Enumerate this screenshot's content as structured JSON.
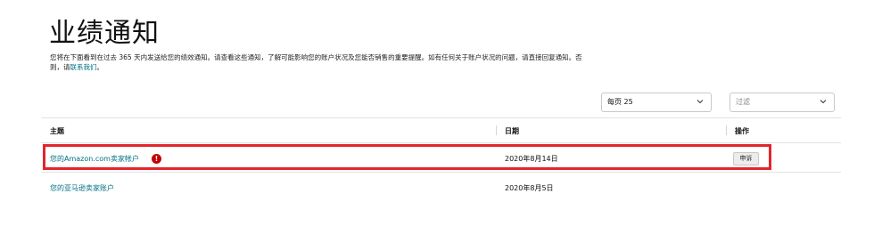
{
  "page": {
    "title": "业绩通知",
    "desc_text": "您将在下面看到在过去 365 天内发送给您的绩效通知。请查看这些通知，了解可能影响您的账户状况及您能否销售的重要提醒。如有任何关于账户状况的问题，请直接回复通知。否则，请",
    "contact_link": "联系我们",
    "desc_end": "。"
  },
  "controls": {
    "per_page": "每页 25",
    "filter_placeholder": "过滤"
  },
  "table": {
    "headers": {
      "subject": "主题",
      "date": "日期",
      "action": "操作"
    },
    "rows": [
      {
        "subject": "您的Amazon.com卖家帐户",
        "alert": "!",
        "date": "2020年8月14日",
        "action": "申诉"
      },
      {
        "subject": "您的亚马逊卖家账户",
        "date": "2020年8月5日"
      }
    ]
  },
  "colors": {
    "link": "#007185",
    "alert": "#c40000",
    "highlight": "#e3252d"
  },
  "icons": [
    "chevron-down-icon",
    "alert-icon"
  ]
}
